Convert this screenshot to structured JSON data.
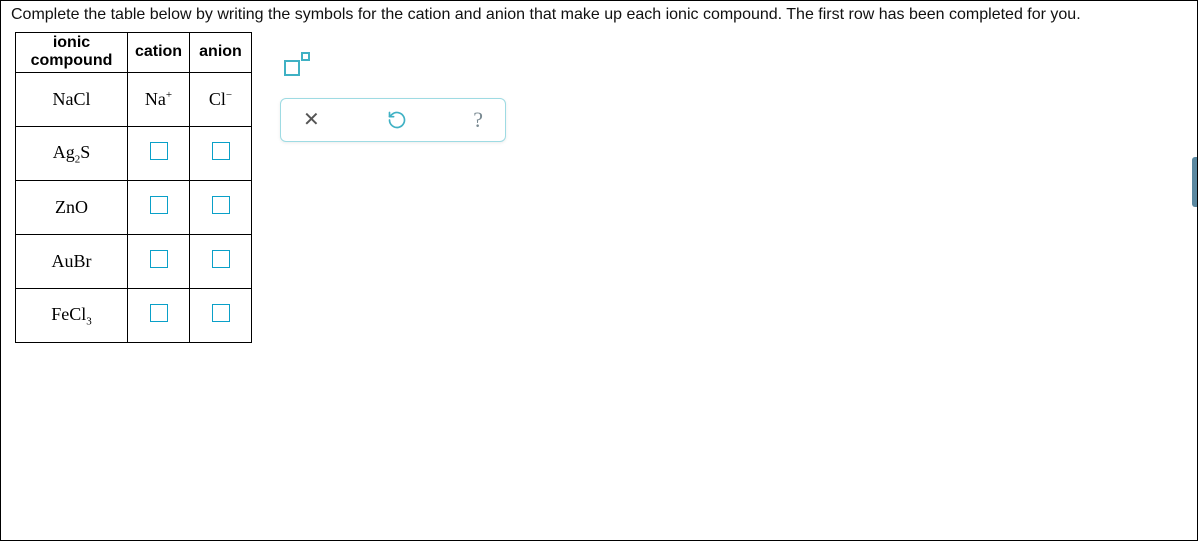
{
  "instruction": "Complete the table below by writing the symbols for the cation and anion that make up each ionic compound. The first row has been completed for you.",
  "columns": {
    "compound": "ionic compound",
    "cation": "cation",
    "anion": "anion"
  },
  "rows": [
    {
      "compound_html": "NaCl",
      "cation_html": "Na<sup>+</sup>",
      "anion_html": "Cl<sup>−</sup>",
      "filled": true
    },
    {
      "compound_html": "Ag<sub>2</sub>S",
      "cation_html": "",
      "anion_html": "",
      "filled": false
    },
    {
      "compound_html": "ZnO",
      "cation_html": "",
      "anion_html": "",
      "filled": false
    },
    {
      "compound_html": "AuBr",
      "cation_html": "",
      "anion_html": "",
      "filled": false
    },
    {
      "compound_html": "FeCl<sub>3</sub>",
      "cation_html": "",
      "anion_html": "",
      "filled": false
    }
  ],
  "tools": {
    "superscript": "superscript",
    "clear": "clear",
    "undo": "undo",
    "help": "help"
  }
}
